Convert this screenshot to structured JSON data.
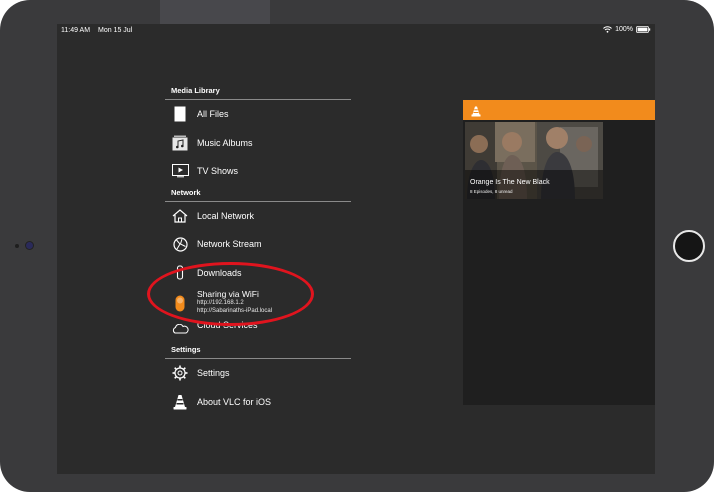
{
  "status_bar": {
    "time": "11:49 AM",
    "date": "Mon 15 Jul",
    "battery": "100%"
  },
  "menu": {
    "media_library_header": "Media Library",
    "media_items": [
      {
        "label": "All Files",
        "icon": "document-icon"
      },
      {
        "label": "Music Albums",
        "icon": "music-album-icon"
      },
      {
        "label": "TV Shows",
        "icon": "tv-icon"
      }
    ],
    "network_header": "Network",
    "network_items": [
      {
        "label": "Local Network",
        "icon": "home-network-icon"
      },
      {
        "label": "Network Stream",
        "icon": "globe-icon"
      },
      {
        "label": "Downloads",
        "icon": "download-icon"
      }
    ],
    "sharing": {
      "label": "Sharing via WiFi",
      "url_ip": "http://192.168.1.2",
      "url_host": "http://Sabarinaths-iPad.local",
      "icon": "wifi-toggle-icon"
    },
    "cloud": {
      "label": "Cloud Services",
      "icon": "cloud-icon"
    },
    "settings_header": "Settings",
    "settings_items": [
      {
        "label": "Settings",
        "icon": "gear-icon"
      },
      {
        "label": "About VLC for iOS",
        "icon": "vlc-cone-icon"
      }
    ]
  },
  "panel": {
    "header_icon": "vlc-cone-icon",
    "accent_color": "#f28b1c",
    "tile": {
      "title": "Orange Is The New Black",
      "subtitle": "8 Episodes, 8 unread"
    }
  },
  "annotation": {
    "color": "#e0141e",
    "shape": "ellipse around Sharing via WiFi"
  }
}
